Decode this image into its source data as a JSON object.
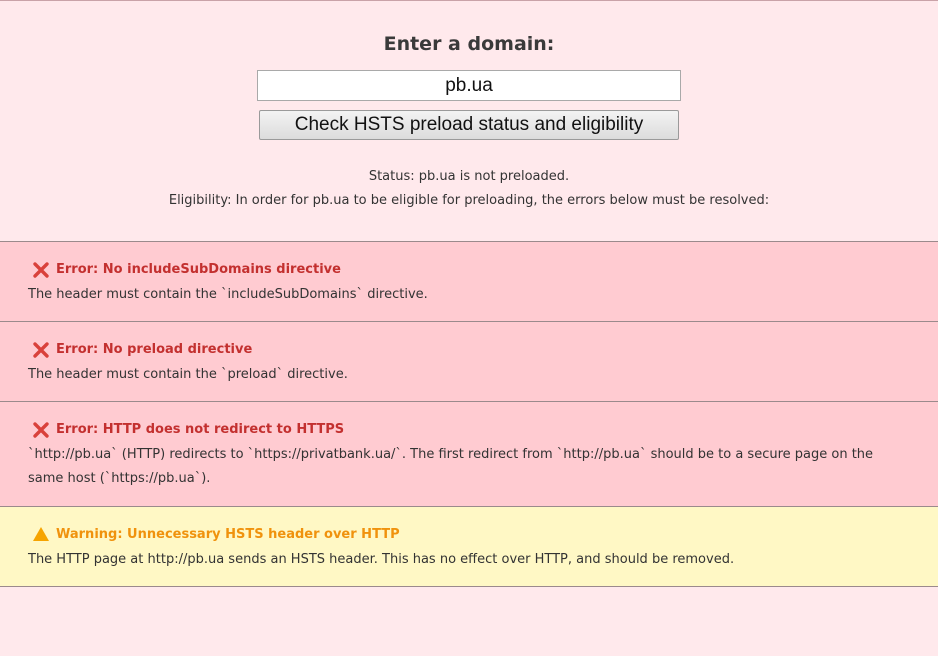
{
  "form": {
    "heading": "Enter a domain:",
    "domain_value": "pb.ua",
    "check_button_label": "Check HSTS preload status and eligibility"
  },
  "result": {
    "status": "Status: pb.ua is not preloaded.",
    "eligibility": "Eligibility: In order for pb.ua to be eligible for preloading, the errors below must be resolved:"
  },
  "issues": [
    {
      "severity": "error",
      "icon": "cross-icon",
      "title": "Error: No includeSubDomains directive",
      "body": "The header must contain the `includeSubDomains` directive."
    },
    {
      "severity": "error",
      "icon": "cross-icon",
      "title": "Error: No preload directive",
      "body": "The header must contain the `preload` directive."
    },
    {
      "severity": "error",
      "icon": "cross-icon",
      "title": "Error: HTTP does not redirect to HTTPS",
      "body": "`http://pb.ua` (HTTP) redirects to `https://privatbank.ua/`. The first redirect from `http://pb.ua` should be to a secure page on the same host (`https://pb.ua`)."
    },
    {
      "severity": "warning",
      "icon": "warning-triangle-icon",
      "title": "Warning: Unnecessary HSTS header over HTTP",
      "body": "The HTTP page at http://pb.ua sends an HSTS header. This has no effect over HTTP, and should be removed."
    }
  ],
  "colors": {
    "page_background": "#ffe9ec",
    "error_background": "#ffcbd1",
    "error_title": "#c3302f",
    "warning_background": "#fff8c5",
    "warning_title": "#f0920d"
  }
}
